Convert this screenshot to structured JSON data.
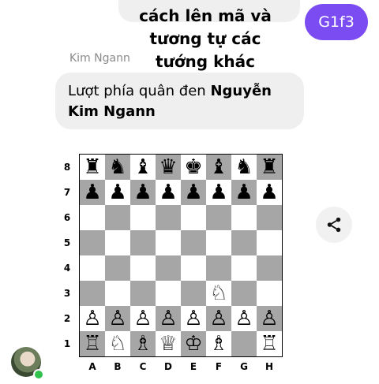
{
  "overlay": {
    "lines": [
      "cách lên mã và",
      "tương tự các",
      "tướng khác"
    ]
  },
  "my_message": {
    "text": "G1f3",
    "color": "#7b4cf2"
  },
  "sender": {
    "name": "Kim Ngann"
  },
  "message": {
    "prefix": "Lượt phía quân đen ",
    "bold": "Nguyễn Kim Ngann"
  },
  "board": {
    "ranks": [
      "8",
      "7",
      "6",
      "5",
      "4",
      "3",
      "2",
      "1"
    ],
    "files": [
      "A",
      "B",
      "C",
      "D",
      "E",
      "F",
      "G",
      "H"
    ],
    "rows": [
      [
        "♜",
        "♞",
        "♝",
        "♛",
        "♚",
        "♝",
        "♞",
        "♜"
      ],
      [
        "♟",
        "♟",
        "♟",
        "♟",
        "♟",
        "♟",
        "♟",
        "♟"
      ],
      [
        "",
        "",
        "",
        "",
        "",
        "",
        "",
        ""
      ],
      [
        "",
        "",
        "",
        "",
        "",
        "",
        "",
        ""
      ],
      [
        "",
        "",
        "",
        "",
        "",
        "",
        "",
        ""
      ],
      [
        "",
        "",
        "",
        "",
        "",
        "♘",
        "",
        ""
      ],
      [
        "♙",
        "♙",
        "♙",
        "♙",
        "♙",
        "♙",
        "♙",
        "♙"
      ],
      [
        "♖",
        "♘",
        "♗",
        "♕",
        "♔",
        "♗",
        "",
        "♖"
      ]
    ],
    "light_color": "#ffffff",
    "dark_color": "#a6a6a6"
  },
  "icons": {
    "share": "share-icon",
    "avatar": "avatar"
  }
}
